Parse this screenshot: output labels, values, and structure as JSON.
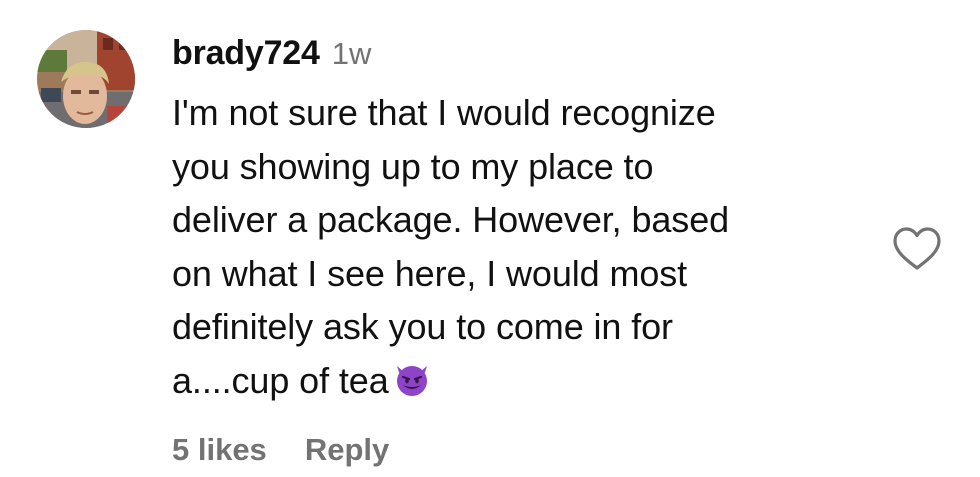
{
  "comment": {
    "username": "brady724",
    "timestamp": "1w",
    "text": "I'm not sure that I would recognize\nyou showing up to my place to\ndeliver a package. However, based\non what I see here, I would most\ndefinitely ask you to come in for\na....cup of tea",
    "emoji": "smiling-face-with-horns-emoji",
    "likes_label": "5 likes",
    "reply_label": "Reply",
    "like_icon": "heart-outline-icon"
  },
  "colors": {
    "text_primary": "#111111",
    "text_secondary": "#737373",
    "emoji_purple": "#8e44c6",
    "background": "#ffffff"
  }
}
